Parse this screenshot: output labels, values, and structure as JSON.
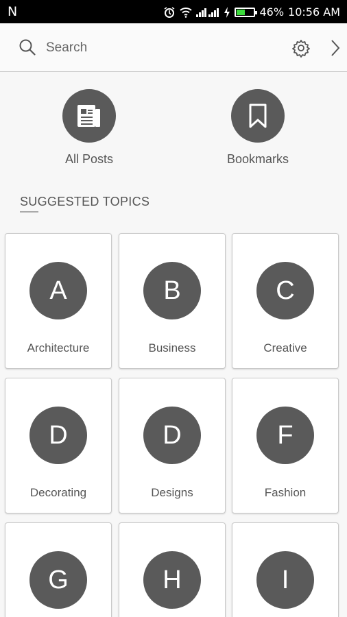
{
  "status_bar": {
    "carrier_icon": "N",
    "battery_percent": "46%",
    "battery_level": 0.46,
    "time": "10:56 AM",
    "icons": [
      "alarm-icon",
      "wifi-icon",
      "signal-icon",
      "signal-icon",
      "charging-icon",
      "battery-icon"
    ]
  },
  "search": {
    "placeholder": "Search",
    "icons": [
      "search-icon",
      "gear-icon",
      "chevron-right-icon"
    ]
  },
  "quick_links": [
    {
      "label": "All Posts",
      "icon": "document-icon"
    },
    {
      "label": "Bookmarks",
      "icon": "bookmark-icon"
    }
  ],
  "section": {
    "title": "SUGGESTED TOPICS"
  },
  "topics": [
    {
      "letter": "A",
      "label": "Architecture"
    },
    {
      "letter": "B",
      "label": "Business"
    },
    {
      "letter": "C",
      "label": "Creative"
    },
    {
      "letter": "D",
      "label": "Decorating"
    },
    {
      "letter": "D",
      "label": "Designs"
    },
    {
      "letter": "F",
      "label": "Fashion"
    },
    {
      "letter": "G",
      "label": ""
    },
    {
      "letter": "H",
      "label": ""
    },
    {
      "letter": "I",
      "label": ""
    }
  ],
  "colors": {
    "status_bar": "#000000",
    "circle": "#5a5a5a",
    "battery_fill": "#3ddc3d"
  }
}
